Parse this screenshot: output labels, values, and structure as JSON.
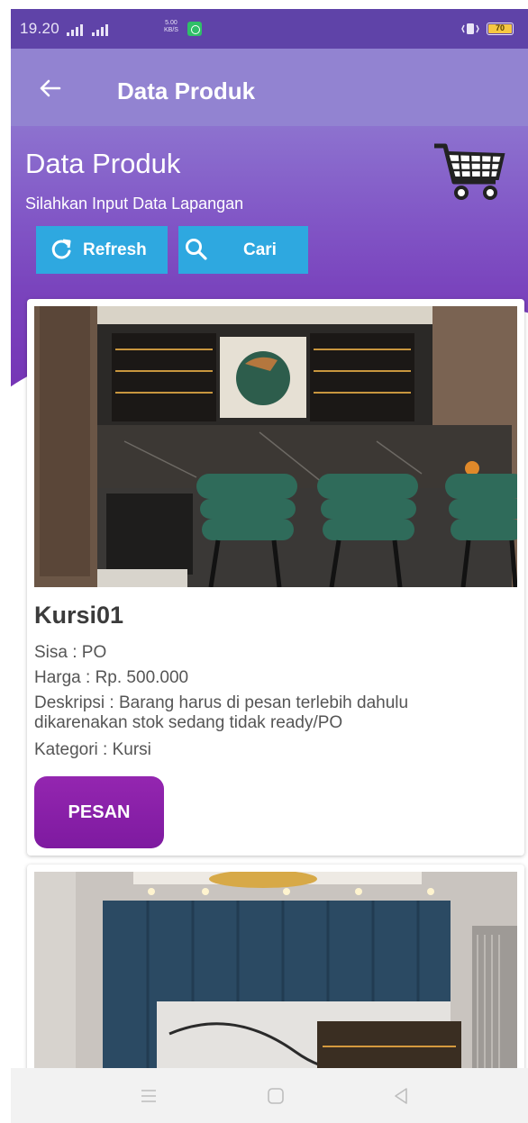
{
  "status_bar": {
    "time": "19.20",
    "net_speed_value": "5.00",
    "net_speed_unit": "KB/S",
    "battery": "70"
  },
  "app_bar": {
    "title": "Data Produk"
  },
  "header": {
    "title": "Data Produk",
    "subtitle": "Silahkan Input Data Lapangan",
    "refresh_label": "Refresh",
    "search_label": "Cari"
  },
  "products": [
    {
      "name": "Kursi01",
      "sisa": "Sisa : PO",
      "harga": "Harga : Rp. 500.000",
      "deskripsi_line1": "Deskripsi : Barang harus di pesan terlebih dahulu",
      "deskripsi_line2": "dikarenakan stok sedang tidak ready/PO",
      "kategori": "Kategori : Kursi",
      "order_label": "PESAN"
    }
  ],
  "colors": {
    "app_bar": "#9283d1",
    "status_bar": "#5f43a8",
    "accent_button": "#2ea8e0",
    "order_button": "#8a20a8"
  }
}
